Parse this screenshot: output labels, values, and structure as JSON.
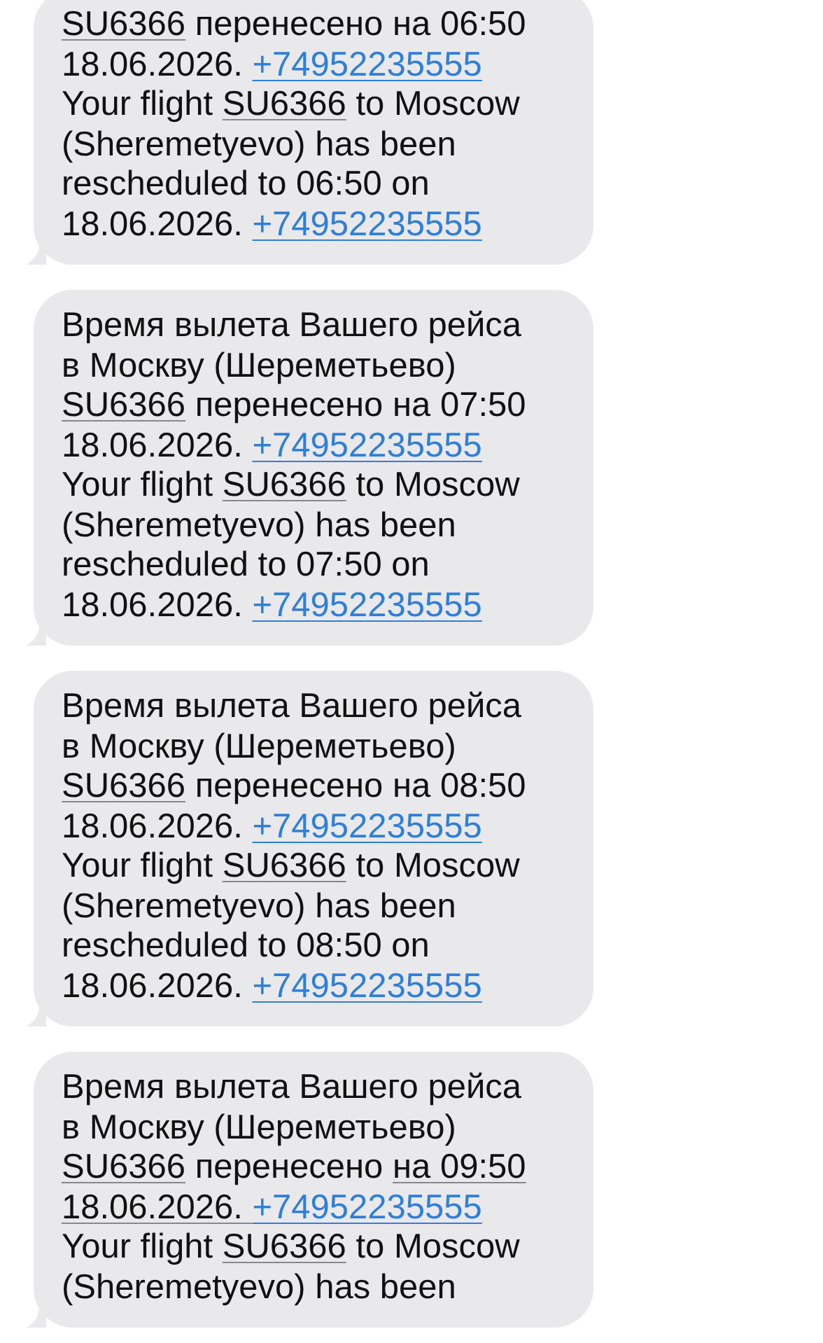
{
  "messages": [
    {
      "lines": [
        [
          {
            "kind": "detected",
            "text": "SU6366"
          },
          {
            "kind": "plain",
            "text": " перенесено на 06:50"
          }
        ],
        [
          {
            "kind": "plain",
            "text": "18.06.2026. "
          },
          {
            "kind": "phone",
            "text": "+74952235555"
          }
        ],
        [
          {
            "kind": "plain",
            "text": "Your flight "
          },
          {
            "kind": "detected",
            "text": "SU6366"
          },
          {
            "kind": "plain",
            "text": " to Moscow"
          }
        ],
        [
          {
            "kind": "plain",
            "text": "(Sheremetyevo) has been"
          }
        ],
        [
          {
            "kind": "plain",
            "text": "rescheduled to 06:50 on"
          }
        ],
        [
          {
            "kind": "plain",
            "text": "18.06.2026. "
          },
          {
            "kind": "phone",
            "text": "+74952235555"
          }
        ]
      ]
    },
    {
      "lines": [
        [
          {
            "kind": "plain",
            "text": "Время вылета Вашего рейса"
          }
        ],
        [
          {
            "kind": "plain",
            "text": "в Москву (Шереметьево)"
          }
        ],
        [
          {
            "kind": "detected",
            "text": "SU6366"
          },
          {
            "kind": "plain",
            "text": " перенесено на 07:50"
          }
        ],
        [
          {
            "kind": "plain",
            "text": "18.06.2026. "
          },
          {
            "kind": "phone",
            "text": "+74952235555"
          }
        ],
        [
          {
            "kind": "plain",
            "text": "Your flight "
          },
          {
            "kind": "detected",
            "text": "SU6366"
          },
          {
            "kind": "plain",
            "text": " to Moscow"
          }
        ],
        [
          {
            "kind": "plain",
            "text": "(Sheremetyevo) has been"
          }
        ],
        [
          {
            "kind": "plain",
            "text": "rescheduled to 07:50 on"
          }
        ],
        [
          {
            "kind": "plain",
            "text": "18.06.2026. "
          },
          {
            "kind": "phone",
            "text": "+74952235555"
          }
        ]
      ]
    },
    {
      "lines": [
        [
          {
            "kind": "plain",
            "text": "Время вылета Вашего рейса"
          }
        ],
        [
          {
            "kind": "plain",
            "text": "в Москву (Шереметьево)"
          }
        ],
        [
          {
            "kind": "detected",
            "text": "SU6366"
          },
          {
            "kind": "plain",
            "text": " перенесено на 08:50"
          }
        ],
        [
          {
            "kind": "plain",
            "text": "18.06.2026. "
          },
          {
            "kind": "phone",
            "text": "+74952235555"
          }
        ],
        [
          {
            "kind": "plain",
            "text": "Your flight "
          },
          {
            "kind": "detected",
            "text": "SU6366"
          },
          {
            "kind": "plain",
            "text": " to Moscow"
          }
        ],
        [
          {
            "kind": "plain",
            "text": "(Sheremetyevo) has been"
          }
        ],
        [
          {
            "kind": "plain",
            "text": "rescheduled to 08:50 on"
          }
        ],
        [
          {
            "kind": "plain",
            "text": "18.06.2026. "
          },
          {
            "kind": "phone",
            "text": "+74952235555"
          }
        ]
      ]
    },
    {
      "lines": [
        [
          {
            "kind": "plain",
            "text": "Время вылета Вашего рейса"
          }
        ],
        [
          {
            "kind": "plain",
            "text": "в Москву (Шереметьево)"
          }
        ],
        [
          {
            "kind": "detected",
            "text": "SU6366"
          },
          {
            "kind": "plain",
            "text": " перенесено "
          },
          {
            "kind": "detected",
            "text": "на 09:50"
          }
        ],
        [
          {
            "kind": "detected",
            "text": "18.06.2026. "
          },
          {
            "kind": "phone",
            "text": "+74952235555"
          }
        ],
        [
          {
            "kind": "plain",
            "text": "Your flight "
          },
          {
            "kind": "detected",
            "text": "SU6366"
          },
          {
            "kind": "plain",
            "text": " to Moscow"
          }
        ],
        [
          {
            "kind": "plain",
            "text": "(Sheremetyevo) has been"
          }
        ]
      ]
    }
  ]
}
